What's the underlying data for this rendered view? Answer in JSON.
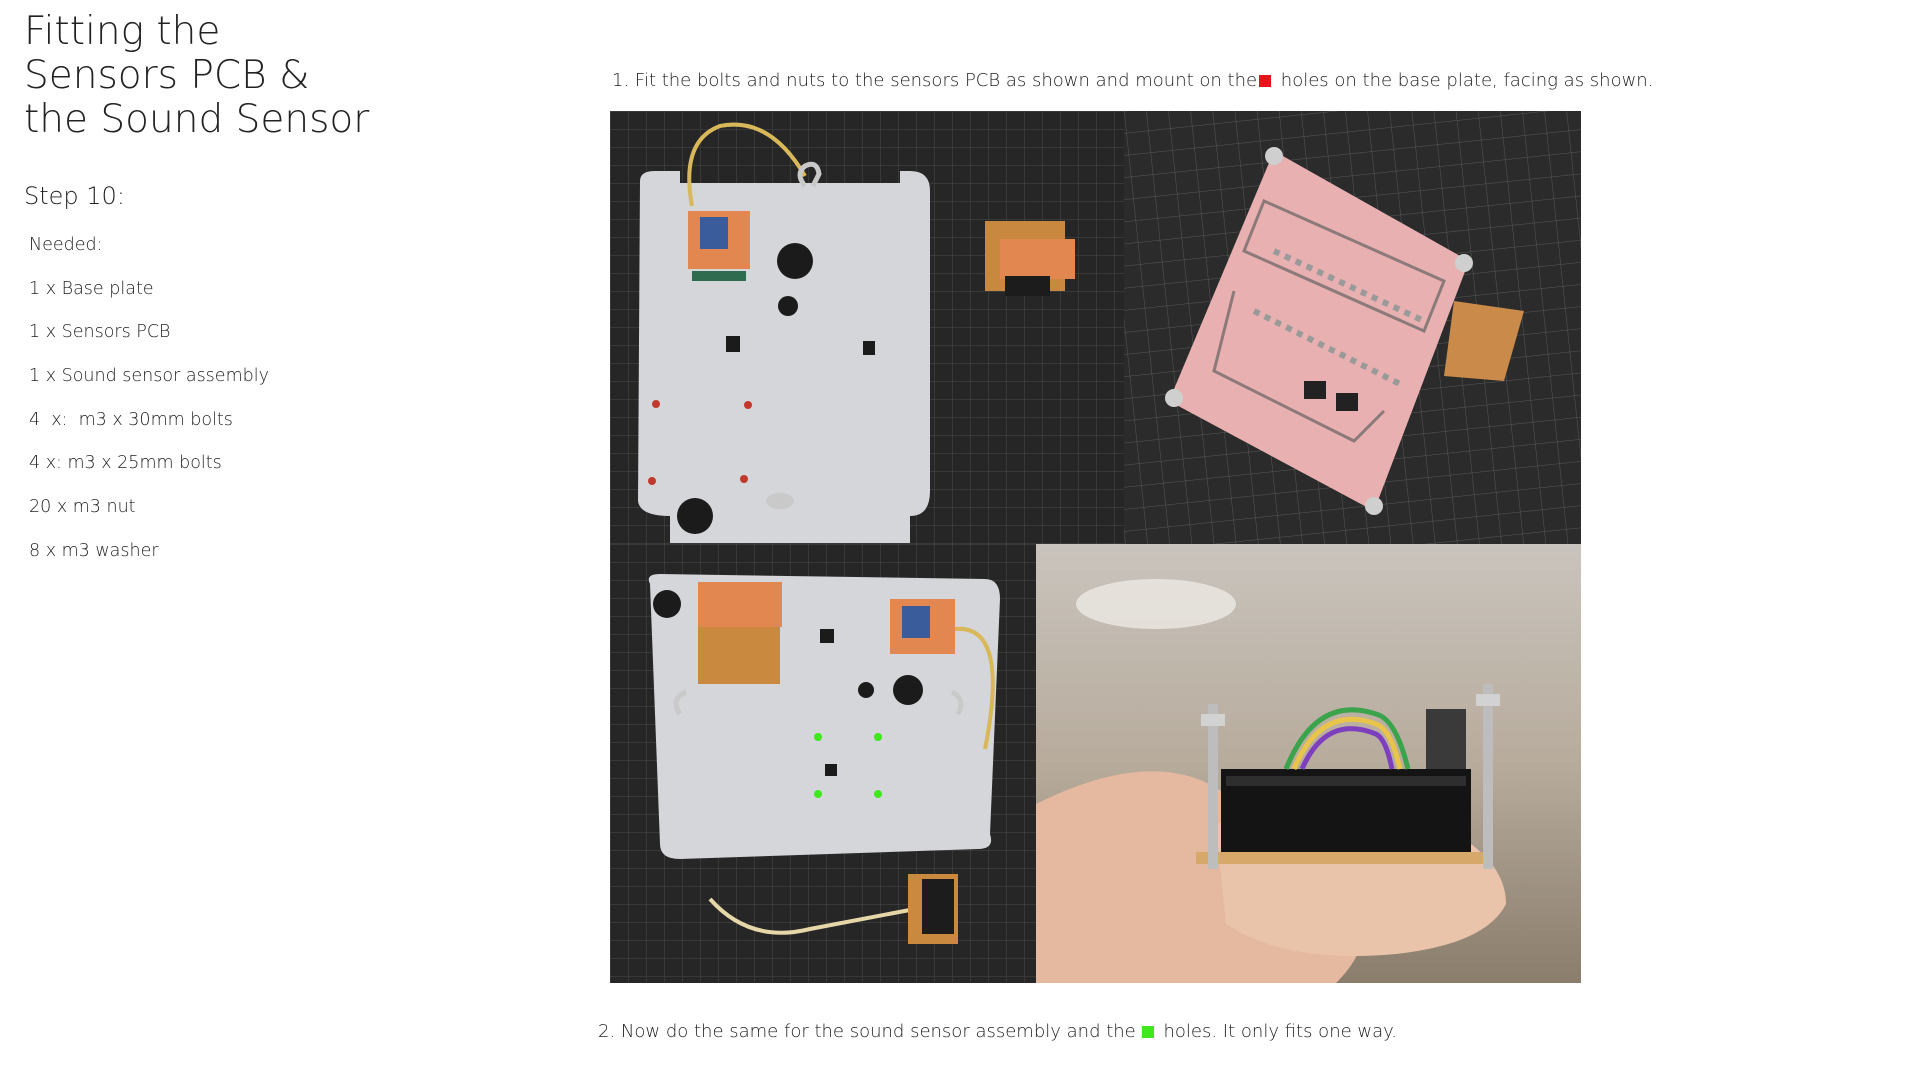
{
  "page": {
    "title": "Fitting the Sensors PCB & the Sound Sensor",
    "step": "Step 10:",
    "needed_label": "Needed:",
    "items": [
      "1 x Base plate",
      "1 x Sensors PCB",
      "1 x Sound sensor assembly",
      "4  x:  m3 x 30mm bolts",
      "4 x: m3 x 25mm bolts",
      "20 x m3 nut",
      "8 x m3 washer"
    ]
  },
  "instructions": {
    "step1_before": "1.  Fit the bolts and nuts to the sensors PCB as shown and mount on the",
    "step1_after": " holes on the base plate, facing as shown.",
    "step2_before": "2. Now do the same for the sound sensor assembly and the",
    "step2_after": " holes. It only fits one way."
  },
  "colors": {
    "red_marker": "#e8141c",
    "green_marker": "#3ee81c"
  }
}
